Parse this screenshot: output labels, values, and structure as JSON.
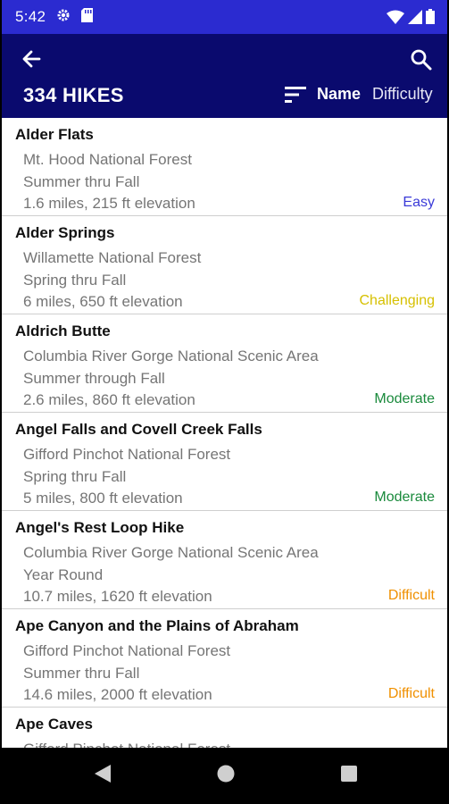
{
  "status_bar": {
    "time": "5:42"
  },
  "header": {
    "count_title": "334 HIKES",
    "sort_name_label": "Name",
    "sort_difficulty_label": "Difficulty"
  },
  "colors": {
    "status_bar": "#2b2bd0",
    "app_bar": "#0a0a6e",
    "easy": "#3a3ad8",
    "challenging": "#d6c000",
    "moderate": "#1a8a3c",
    "difficult": "#f09000"
  },
  "hikes": [
    {
      "name": "Alder Flats",
      "forest": "Mt. Hood National Forest",
      "season": "Summer thru Fall",
      "stats": "1.6 miles,  215 ft elevation",
      "difficulty": "Easy",
      "difficulty_color": "#3a3ad8"
    },
    {
      "name": "Alder Springs",
      "forest": "Willamette National Forest",
      "season": "Spring thru Fall",
      "stats": "6 miles,  650 ft elevation",
      "difficulty": "Challenging",
      "difficulty_color": "#d6c000"
    },
    {
      "name": "Aldrich Butte",
      "forest": "Columbia River Gorge National Scenic Area",
      "season": "Summer through Fall",
      "stats": "2.6 miles, 860 ft elevation",
      "difficulty": "Moderate",
      "difficulty_color": "#1a8a3c"
    },
    {
      "name": "Angel Falls and Covell Creek Falls",
      "forest": "Gifford Pinchot National Forest",
      "season": "Spring thru Fall",
      "stats": "5 miles, 800 ft elevation",
      "difficulty": "Moderate",
      "difficulty_color": "#1a8a3c"
    },
    {
      "name": "Angel's Rest Loop Hike",
      "forest": "Columbia River Gorge National Scenic Area",
      "season": "Year Round",
      "stats": "10.7 miles, 1620 ft elevation",
      "difficulty": "Difficult",
      "difficulty_color": "#f09000"
    },
    {
      "name": "Ape Canyon and the Plains of Abraham",
      "forest": "Gifford Pinchot National Forest",
      "season": "Summer thru Fall",
      "stats": "14.6 miles, 2000 ft elevation",
      "difficulty": "Difficult",
      "difficulty_color": "#f09000"
    },
    {
      "name": "Ape Caves",
      "forest": "Gifford Pinchot National Forest",
      "season": "",
      "stats": "",
      "difficulty": "",
      "difficulty_color": "#f09000"
    }
  ]
}
